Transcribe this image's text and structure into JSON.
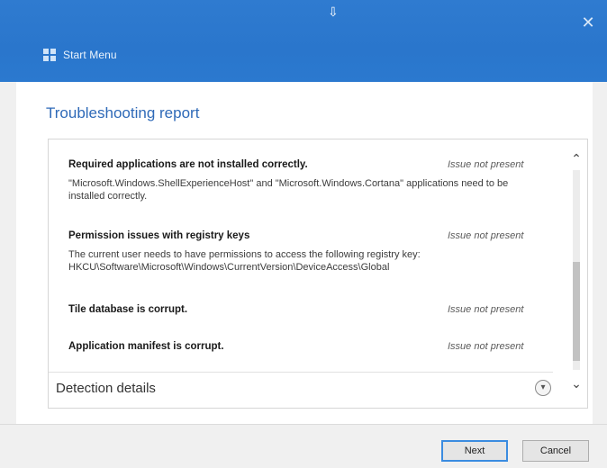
{
  "window": {
    "app_title": "Start Menu",
    "close_glyph": "✕",
    "cursor_glyph": "⇩"
  },
  "report": {
    "title": "Troubleshooting report"
  },
  "issues": [
    {
      "name": "Required applications are not installed correctly.",
      "status": "Issue not present",
      "description": "\"Microsoft.Windows.ShellExperienceHost\" and \"Microsoft.Windows.Cortana\" applications need to be installed correctly."
    },
    {
      "name": "Permission issues with registry keys",
      "status": "Issue not present",
      "description": "The current user needs to have permissions to access the following registry key: HKCU\\Software\\Microsoft\\Windows\\CurrentVersion\\DeviceAccess\\Global"
    },
    {
      "name": "Tile database is corrupt.",
      "status": "Issue not present",
      "description": ""
    },
    {
      "name": "Application manifest is corrupt.",
      "status": "Issue not present",
      "description": ""
    }
  ],
  "detection": {
    "label": "Detection details",
    "expand_glyph": "▾"
  },
  "scroll": {
    "up_glyph": "⌃",
    "down_glyph": "⌄"
  },
  "buttons": {
    "next": "Next",
    "cancel": "Cancel"
  },
  "colors": {
    "titlebar": "#2b79cf",
    "title_text": "#2f6ab8",
    "focus_border": "#3b8ce0"
  }
}
